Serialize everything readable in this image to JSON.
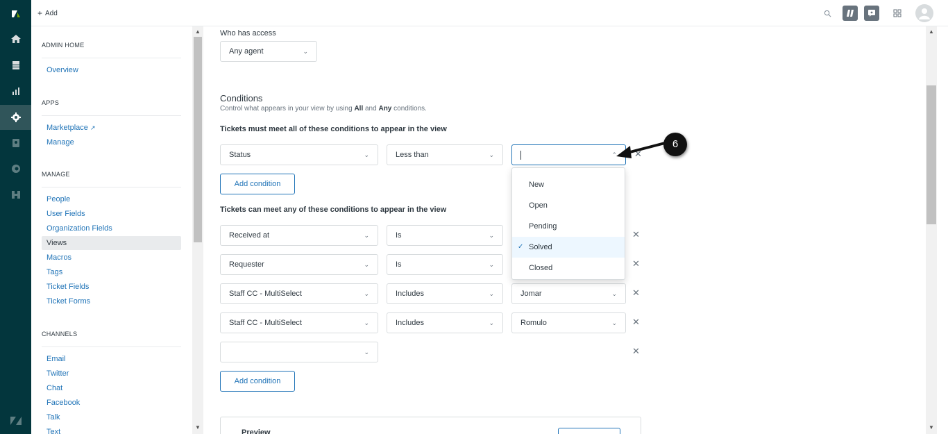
{
  "topbar": {
    "add_label": "Add"
  },
  "sidebar": {
    "admin_home": {
      "title": "ADMIN HOME",
      "items": [
        "Overview"
      ]
    },
    "apps": {
      "title": "APPS",
      "items": [
        "Marketplace",
        "Manage"
      ]
    },
    "manage": {
      "title": "MANAGE",
      "items": [
        "People",
        "User Fields",
        "Organization Fields",
        "Views",
        "Macros",
        "Tags",
        "Ticket Fields",
        "Ticket Forms"
      ],
      "active": "Views"
    },
    "channels": {
      "title": "CHANNELS",
      "items": [
        "Email",
        "Twitter",
        "Chat",
        "Facebook",
        "Talk",
        "Text"
      ]
    }
  },
  "access": {
    "label": "Who has access",
    "value": "Any agent"
  },
  "conditions": {
    "title": "Conditions",
    "subtitle_prefix": "Control what appears in your view by using ",
    "subtitle_all": "All",
    "subtitle_and": " and ",
    "subtitle_any": "Any",
    "subtitle_suffix": " conditions.",
    "all_heading": "Tickets must meet all of these conditions to appear in the view",
    "any_heading": "Tickets can meet any of these conditions to appear in the view",
    "add_label": "Add condition",
    "all_rows": [
      {
        "field": "Status",
        "operator": "Less than",
        "value": ""
      }
    ],
    "any_rows": [
      {
        "field": "Received at",
        "operator": "Is",
        "value": ""
      },
      {
        "field": "Requester",
        "operator": "Is",
        "value": ""
      },
      {
        "field": "Staff CC - MultiSelect",
        "operator": "Includes",
        "value": "Jomar"
      },
      {
        "field": "Staff CC - MultiSelect",
        "operator": "Includes",
        "value": "Romulo"
      },
      {
        "field": "",
        "operator": "",
        "value": ""
      }
    ]
  },
  "dropdown": {
    "options": [
      "New",
      "Open",
      "Pending",
      "Solved",
      "Closed"
    ],
    "selected": "Solved"
  },
  "preview": {
    "label": "Preview"
  },
  "callout": {
    "number": "6"
  },
  "colors": {
    "rail": "#03363d",
    "accent": "#1f73b7",
    "annotation": "#111111"
  }
}
